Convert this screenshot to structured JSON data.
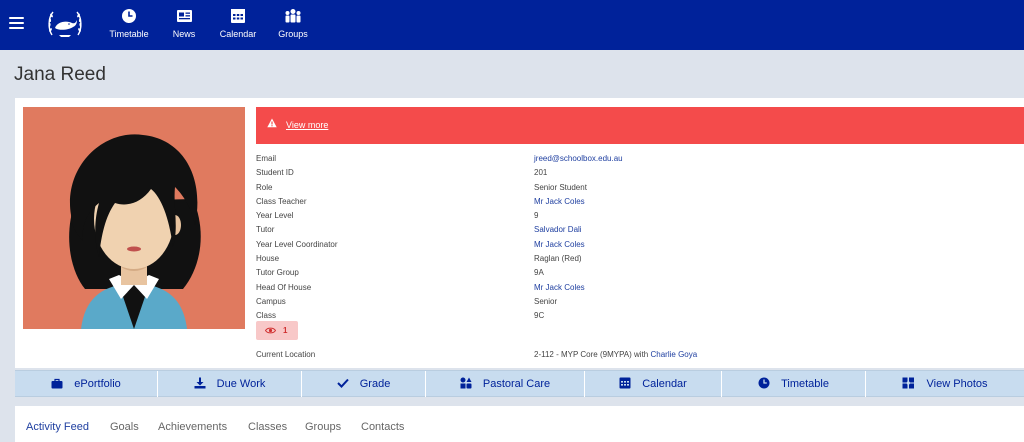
{
  "nav": {
    "items": [
      {
        "label": "Timetable",
        "icon": "clock-icon"
      },
      {
        "label": "News",
        "icon": "news-icon"
      },
      {
        "label": "Calendar",
        "icon": "calendar-icon"
      },
      {
        "label": "Groups",
        "icon": "groups-icon"
      }
    ]
  },
  "colors": {
    "brand": "#00229a",
    "alert": "#f44b4b",
    "link": "#1f3fa0",
    "action_bar": "#c8dcef"
  },
  "profile": {
    "name": "Jana Reed",
    "alert_link": "View more",
    "details": [
      {
        "key": "Email",
        "value": "jreed@schoolbox.edu.au"
      },
      {
        "key": "Student ID",
        "value": "201"
      },
      {
        "key": "Role",
        "value": "Senior Student"
      },
      {
        "key": "Class Teacher",
        "value": "Mr Jack Coles"
      },
      {
        "key": "Year Level",
        "value": "9"
      },
      {
        "key": "Tutor",
        "value": "Salvador Dali"
      },
      {
        "key": "Year Level Coordinator",
        "value": "Mr Jack Coles"
      },
      {
        "key": "House",
        "value": "Raglan (Red)"
      },
      {
        "key": "Tutor Group",
        "value": "9A"
      },
      {
        "key": "Head Of House",
        "value": "Mr Jack Coles"
      },
      {
        "key": "Campus",
        "value": "Senior"
      },
      {
        "key": "Class",
        "value": "9C"
      }
    ],
    "views_count": "1",
    "location": {
      "key": "Current Location",
      "value_prefix": "2-112 - MYP Core (9MYPA) with",
      "value_link": "Charlie Goya"
    }
  },
  "actions": [
    {
      "label": "ePortfolio",
      "icon": "briefcase-icon"
    },
    {
      "label": "Due Work",
      "icon": "download-icon"
    },
    {
      "label": "Grade",
      "icon": "check-icon"
    },
    {
      "label": "Pastoral Care",
      "icon": "shapes-icon"
    },
    {
      "label": "Calendar",
      "icon": "calendar-icon"
    },
    {
      "label": "Timetable",
      "icon": "clock-icon"
    },
    {
      "label": "View Photos",
      "icon": "photos-icon"
    }
  ],
  "tabs": [
    {
      "label": "Activity Feed",
      "active": true
    },
    {
      "label": "Goals"
    },
    {
      "label": "Achievements"
    },
    {
      "label": "Classes"
    },
    {
      "label": "Groups"
    },
    {
      "label": "Contacts"
    }
  ]
}
